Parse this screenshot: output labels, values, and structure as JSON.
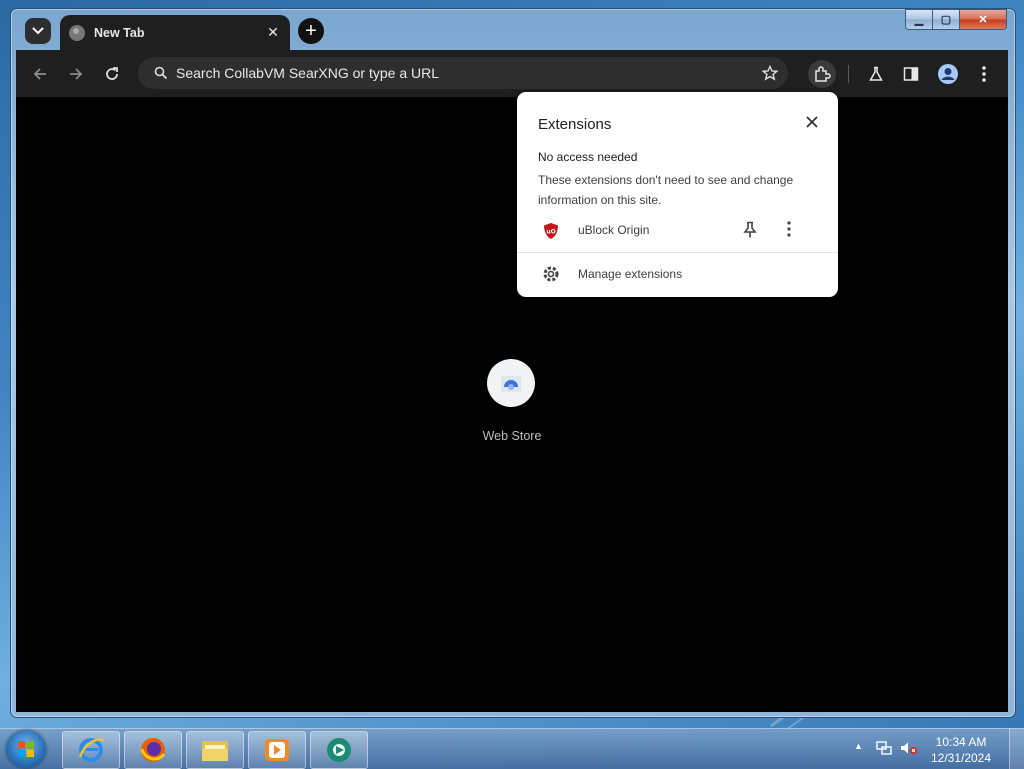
{
  "window": {
    "caption": {
      "minimize_glyph": "▁",
      "maximize_glyph": "▢",
      "close_glyph": "✕"
    }
  },
  "browser": {
    "tab": {
      "title": "New Tab",
      "close_glyph": "✕"
    },
    "tab_search_glyph": "⌄",
    "newtab_glyph": "+",
    "omnibox": {
      "placeholder": "Search CollabVM SearXNG or type a URL"
    },
    "icons": [
      "back-icon",
      "forward-icon",
      "reload-icon",
      "search-icon",
      "star-icon",
      "extensions-icon",
      "labs-icon",
      "side-panel-icon",
      "profile-icon",
      "menu-icon"
    ]
  },
  "newtab_page": {
    "shortcut": {
      "label": "Web Store"
    }
  },
  "extensions_popup": {
    "title": "Extensions",
    "close_glyph": "✕",
    "section_heading": "No access needed",
    "description": "These extensions don't need to see and change information on this site.",
    "extension": {
      "name": "uBlock Origin"
    },
    "manage_label": "Manage extensions"
  },
  "taskbar": {
    "pinned": [
      "internet-explorer",
      "firefox",
      "file-explorer",
      "media-player",
      "chrome"
    ],
    "clock": {
      "time": "10:34 AM",
      "date": "12/31/2024"
    },
    "tray_arrow": "▲"
  },
  "colors": {
    "chrome_dark": "#1f1f1f",
    "omnibox_bg": "#2e2e2e",
    "popup_bg": "#ffffff",
    "ublock_red": "#c4161c",
    "taskbar_blue": "#3f6fa6"
  }
}
